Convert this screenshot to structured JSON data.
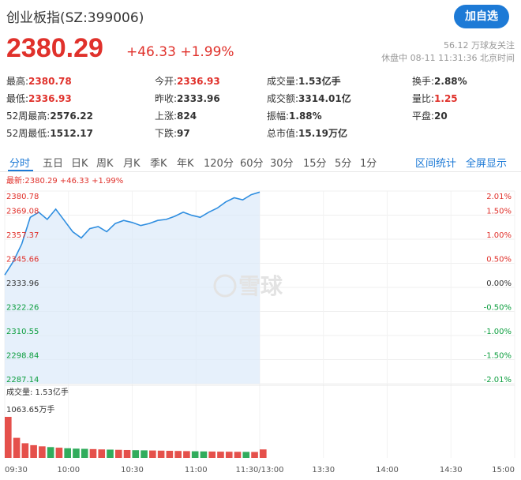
{
  "header": {
    "title": "创业板指(SZ:399006)",
    "follow_label": "加自选"
  },
  "price": {
    "current": "2380.29",
    "change": "+46.33",
    "change_pct": "+1.99%"
  },
  "meta": {
    "followers": "56.12 万球友关注",
    "status": "休盘中 08-11 11:31:36 北京时间"
  },
  "quote": {
    "row1": {
      "high_label": "最高:",
      "high": "2380.78",
      "open_label": "今开:",
      "open": "2336.93",
      "volume_label": "成交量:",
      "volume": "1.53亿手",
      "turnover_label": "换手:",
      "turnover": "2.88%"
    },
    "row2": {
      "low_label": "最低:",
      "low": "2336.93",
      "prev_label": "昨收:",
      "prev": "2333.96",
      "amount_label": "成交额:",
      "amount": "3314.01亿",
      "ratio_label": "量比:",
      "ratio": "1.25"
    },
    "row3": {
      "w52h_label": "52周最高:",
      "w52h": "2576.22",
      "up_label": "上涨:",
      "up": "824",
      "amp_label": "振幅:",
      "amp": "1.88%",
      "flat_label": "平盘:",
      "flat": "20"
    },
    "row4": {
      "w52l_label": "52周最低:",
      "w52l": "1512.17",
      "down_label": "下跌:",
      "down": "97",
      "mcap_label": "总市值:",
      "mcap": "15.19万亿"
    }
  },
  "tabs": {
    "items": [
      "分时",
      "五日",
      "日K",
      "周K",
      "月K",
      "季K",
      "年K",
      "120分",
      "60分",
      "30分",
      "15分",
      "5分",
      "1分"
    ],
    "active": 0,
    "interval_stats": "区间统计",
    "fullscreen": "全屏显示"
  },
  "latest_line": "最新:2380.29 +46.33 +1.99%",
  "colors": {
    "up": "#e0312b",
    "down": "#0d9e3f",
    "accent": "#1d7ad6",
    "line": "#2f8ee0"
  },
  "watermark": "雪球",
  "chart_data": {
    "type": "area",
    "price_axis": [
      "2380.78",
      "2369.08",
      "2357.37",
      "2345.66",
      "2333.96",
      "2322.26",
      "2310.55",
      "2298.84",
      "2287.14"
    ],
    "pct_axis": [
      "2.01%",
      "1.50%",
      "1.00%",
      "0.50%",
      "0.00%",
      "-0.50%",
      "-1.00%",
      "-1.50%",
      "-2.01%"
    ],
    "ylim": [
      2287.14,
      2380.78
    ],
    "time_axis": [
      "09:30",
      "10:00",
      "10:30",
      "11:00",
      "11:30/13:00",
      "13:30",
      "14:00",
      "14:30",
      "15:00"
    ],
    "volume_label": "成交量: 1.53亿手",
    "volume_max_label": "1063.65万手",
    "x": [
      0,
      4,
      8,
      12,
      16,
      20,
      24,
      28,
      32,
      36,
      40,
      44,
      48,
      52,
      56,
      60,
      64,
      68,
      72,
      76,
      80,
      84,
      88,
      92,
      96,
      100,
      104,
      108,
      112,
      116,
      120
    ],
    "y": [
      2340.0,
      2346.5,
      2355.0,
      2368.0,
      2370.5,
      2367.0,
      2372.0,
      2366.5,
      2361.0,
      2358.0,
      2362.5,
      2363.5,
      2361.0,
      2365.0,
      2366.5,
      2365.5,
      2364.0,
      2365.0,
      2366.5,
      2367.0,
      2368.5,
      2370.5,
      2369.0,
      2368.0,
      2370.5,
      2372.5,
      2375.5,
      2377.5,
      2376.5,
      2379.0,
      2380.29
    ],
    "volume": [
      1063.65,
      520,
      380,
      330,
      300,
      280,
      265,
      250,
      240,
      235,
      228,
      220,
      215,
      210,
      205,
      200,
      196,
      192,
      188,
      184,
      180,
      176,
      172,
      168,
      165,
      162,
      160,
      158,
      156,
      154,
      220
    ]
  }
}
